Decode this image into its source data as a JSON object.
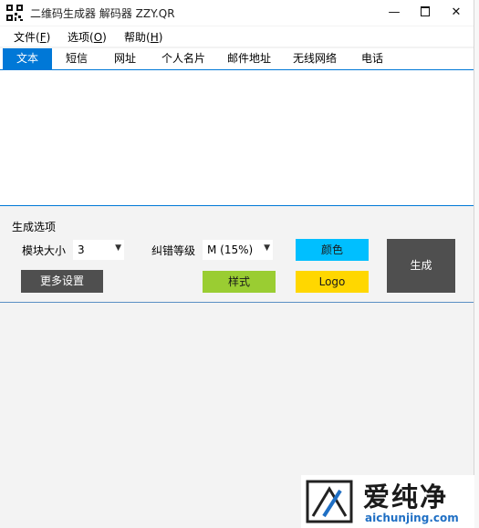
{
  "window": {
    "title": "二维码生成器 解码器 ZZY.QR"
  },
  "titlebar": {
    "minimize_glyph": "—",
    "close_glyph": "✕"
  },
  "menu": [
    {
      "label": "文件(",
      "key": "F",
      "suffix": ")"
    },
    {
      "label": "选项(",
      "key": "O",
      "suffix": ")"
    },
    {
      "label": "帮助(",
      "key": "H",
      "suffix": ")"
    }
  ],
  "tabs": [
    "文本",
    "短信",
    "网址",
    "个人名片",
    "邮件地址",
    "无线网络",
    "电话"
  ],
  "active_tab": "文本",
  "text_input": {
    "value": ""
  },
  "options": {
    "section_title": "生成选项",
    "module_size_label": "模块大小",
    "module_size_value": "3",
    "error_correction_label": "纠错等级",
    "error_correction_value": "M (15%)",
    "more_settings_label": "更多设置",
    "style_label": "样式",
    "color_label": "颜色",
    "logo_label": "Logo",
    "generate_label": "生成"
  },
  "colors": {
    "accent": "#0078d7",
    "style_button": "#9acd32",
    "color_button": "#00bfff",
    "logo_button": "#ffd700",
    "dark_button": "#4f4f4f"
  },
  "icons": {
    "dropdown_arrow": "▼"
  },
  "watermark": {
    "brand": "爱纯净",
    "url": "aichunjing.com"
  }
}
